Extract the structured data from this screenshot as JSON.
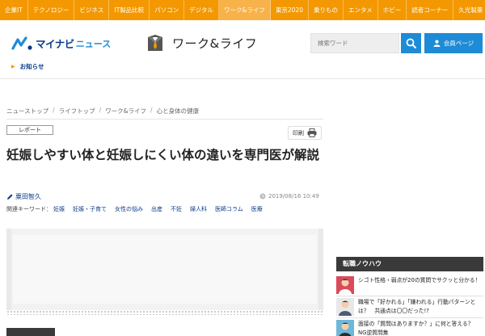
{
  "topnav": {
    "items": [
      "企業IT",
      "テクノロジー",
      "ビジネス",
      "IT製品比較",
      "パソコン",
      "デジタル",
      "ワーク&ライフ",
      "東京2020",
      "乗りもの",
      "エンタメ",
      "ホビー",
      "読者コーナー",
      "久光製薬"
    ],
    "active_index": 6
  },
  "header": {
    "logo_main": "マイナビ",
    "logo_sub": "ニュース",
    "section_title": "ワーク&ライフ",
    "search_placeholder": "検索ワード",
    "member_label": "会員ページ",
    "notice": "お知らせ"
  },
  "breadcrumb": [
    "ニューストップ",
    "ライフトップ",
    "ワーク&ライフ",
    "心と身体の健康"
  ],
  "article": {
    "tag": "レポート",
    "print_label": "印刷",
    "title": "妊娠しやすい体と妊娠しにくい体の違いを専門医が解説",
    "author": "粟田智久",
    "date": "2019/08/16 10:49",
    "keywords_label": "関連キーワード：",
    "keywords": [
      "妊娠",
      "妊娠・子育て",
      "女性の悩み",
      "出産",
      "不妊",
      "婦人科",
      "医師コラム",
      "医療"
    ]
  },
  "sidebar": {
    "heading": "転職ノウハウ",
    "items": [
      {
        "text": "シゴト性格・弱点が20の質問でサクッと分かる！"
      },
      {
        "text": "職場で「好かれる」「嫌われる」行動パターンとは？　共通点は〇〇だった!?"
      },
      {
        "text": "面接の「質問はありますか？」に何と答える？　NG逆質問集"
      }
    ]
  },
  "colors": {
    "brand_orange": "#f39800",
    "brand_blue": "#1e8bd6",
    "navy": "#0a3c8c"
  }
}
